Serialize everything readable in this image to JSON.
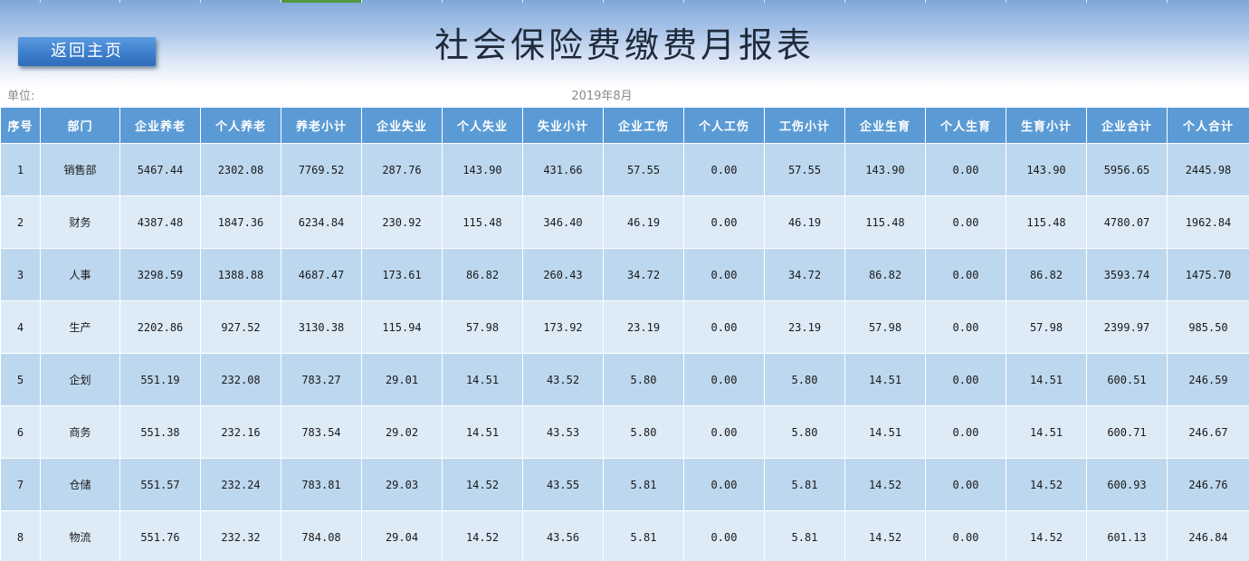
{
  "header": {
    "title": "社会保险费缴费月报表",
    "back_button_label": "返回主页",
    "unit_label": "单位:",
    "period": "2019年8月"
  },
  "colors": {
    "header_bg": "#5b9bd5",
    "row_dark": "#bdd7ee",
    "row_light": "#ddebf7",
    "button_bg": "#3d7fcc",
    "tab_indicator": "#4f9a3c"
  },
  "table": {
    "columns": [
      "序号",
      "部门",
      "企业养老",
      "个人养老",
      "养老小计",
      "企业失业",
      "个人失业",
      "失业小计",
      "企业工伤",
      "个人工伤",
      "工伤小计",
      "企业生育",
      "个人生育",
      "生育小计",
      "企业合计",
      "个人合计"
    ],
    "rows": [
      [
        "1",
        "销售部",
        "5467.44",
        "2302.08",
        "7769.52",
        "287.76",
        "143.90",
        "431.66",
        "57.55",
        "0.00",
        "57.55",
        "143.90",
        "0.00",
        "143.90",
        "5956.65",
        "2445.98"
      ],
      [
        "2",
        "财务",
        "4387.48",
        "1847.36",
        "6234.84",
        "230.92",
        "115.48",
        "346.40",
        "46.19",
        "0.00",
        "46.19",
        "115.48",
        "0.00",
        "115.48",
        "4780.07",
        "1962.84"
      ],
      [
        "3",
        "人事",
        "3298.59",
        "1388.88",
        "4687.47",
        "173.61",
        "86.82",
        "260.43",
        "34.72",
        "0.00",
        "34.72",
        "86.82",
        "0.00",
        "86.82",
        "3593.74",
        "1475.70"
      ],
      [
        "4",
        "生产",
        "2202.86",
        "927.52",
        "3130.38",
        "115.94",
        "57.98",
        "173.92",
        "23.19",
        "0.00",
        "23.19",
        "57.98",
        "0.00",
        "57.98",
        "2399.97",
        "985.50"
      ],
      [
        "5",
        "企划",
        "551.19",
        "232.08",
        "783.27",
        "29.01",
        "14.51",
        "43.52",
        "5.80",
        "0.00",
        "5.80",
        "14.51",
        "0.00",
        "14.51",
        "600.51",
        "246.59"
      ],
      [
        "6",
        "商务",
        "551.38",
        "232.16",
        "783.54",
        "29.02",
        "14.51",
        "43.53",
        "5.80",
        "0.00",
        "5.80",
        "14.51",
        "0.00",
        "14.51",
        "600.71",
        "246.67"
      ],
      [
        "7",
        "仓储",
        "551.57",
        "232.24",
        "783.81",
        "29.03",
        "14.52",
        "43.55",
        "5.81",
        "0.00",
        "5.81",
        "14.52",
        "0.00",
        "14.52",
        "600.93",
        "246.76"
      ],
      [
        "8",
        "物流",
        "551.76",
        "232.32",
        "784.08",
        "29.04",
        "14.52",
        "43.56",
        "5.81",
        "0.00",
        "5.81",
        "14.52",
        "0.00",
        "14.52",
        "601.13",
        "246.84"
      ]
    ]
  }
}
